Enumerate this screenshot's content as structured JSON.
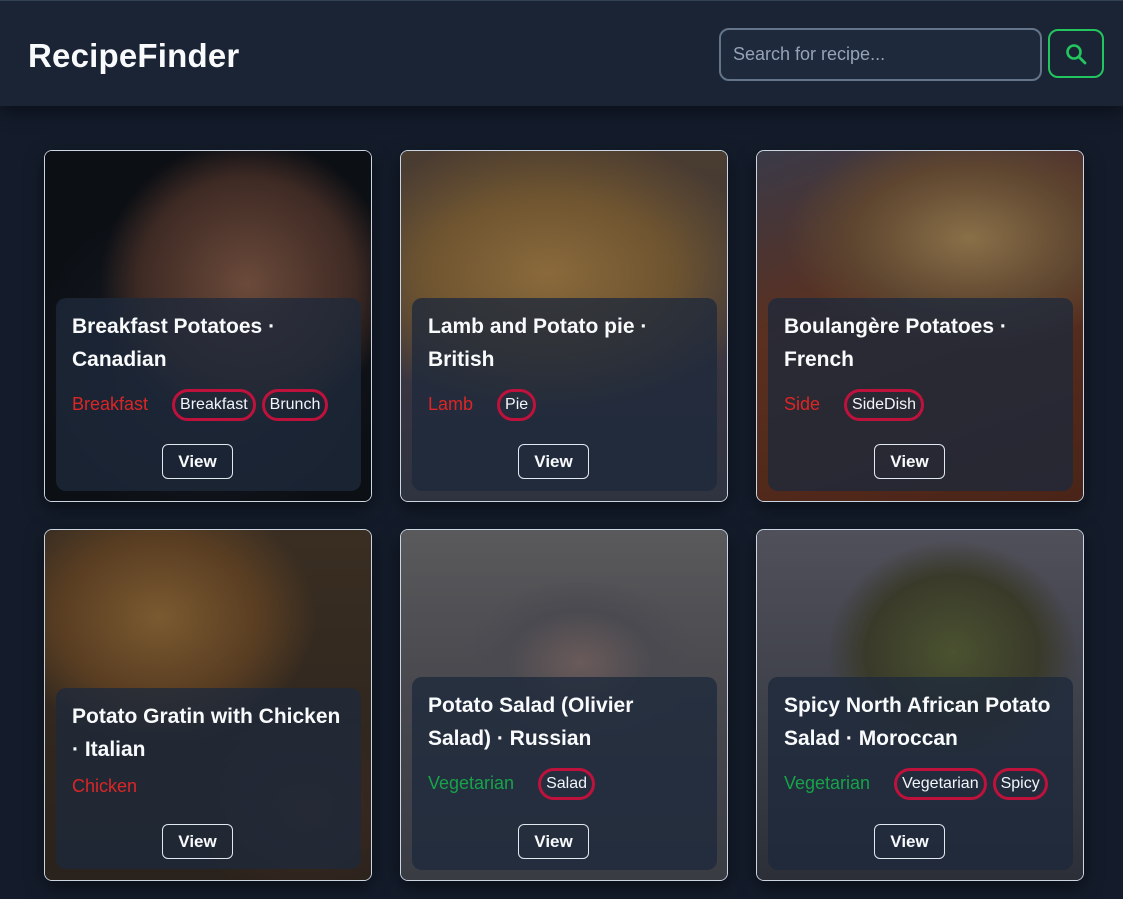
{
  "app": {
    "title": "RecipeFinder"
  },
  "search": {
    "placeholder": "Search for recipe...",
    "value": ""
  },
  "theme": {
    "accent": "#22c55e",
    "tag_border": "#be123c",
    "category_red": "#dc2626",
    "category_green": "#16a34a"
  },
  "recipes": [
    {
      "title": "Breakfast Potatoes · Canadian",
      "category": "Breakfast",
      "category_color": "red",
      "tags": [
        "Breakfast",
        "Brunch"
      ],
      "view_label": "View"
    },
    {
      "title": "Lamb and Potato pie · British",
      "category": "Lamb",
      "category_color": "red",
      "tags": [
        "Pie"
      ],
      "view_label": "View"
    },
    {
      "title": "Boulangère Potatoes · French",
      "category": "Side",
      "category_color": "red",
      "tags": [
        "SideDish"
      ],
      "view_label": "View"
    },
    {
      "title": "Potato Gratin with Chicken · Italian",
      "category": "Chicken",
      "category_color": "red",
      "tags": [],
      "view_label": "View"
    },
    {
      "title": "Potato Salad (Olivier Salad) · Russian",
      "category": "Vegetarian",
      "category_color": "green",
      "tags": [
        "Salad"
      ],
      "view_label": "View"
    },
    {
      "title": "Spicy North African Potato Salad · Moroccan",
      "category": "Vegetarian",
      "category_color": "green",
      "tags": [
        "Vegetarian",
        "Spicy"
      ],
      "view_label": "View"
    }
  ]
}
